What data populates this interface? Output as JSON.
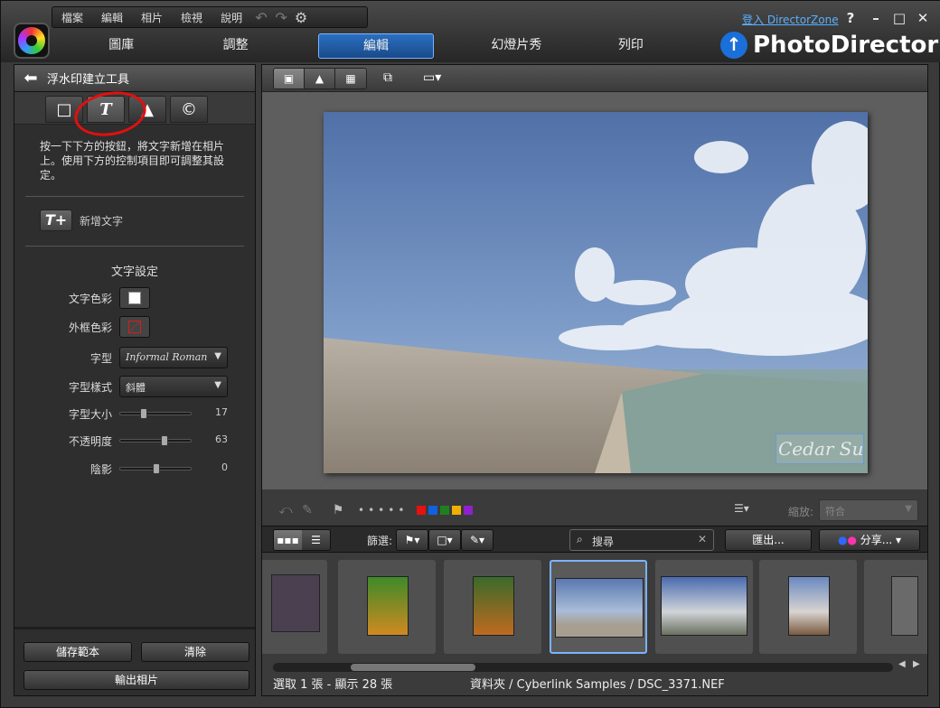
{
  "window": {
    "login_link": "登入 DirectorZone",
    "help": "?",
    "minimize": "–",
    "maximize": "□",
    "close": "✕"
  },
  "menu": [
    "檔案",
    "編輯",
    "相片",
    "檢視",
    "說明"
  ],
  "tabs": [
    "圖庫",
    "調整",
    "編輯",
    "幻燈片秀",
    "列印"
  ],
  "active_tab": "編輯",
  "brand": "PhotoDirector",
  "left_panel": {
    "title": "浮水印建立工具",
    "tool_tabs": [
      "□",
      "T",
      "▲",
      "©"
    ],
    "description": "按一下下方的按鈕，將文字新增在相片上。使用下方的控制項目即可調整其設定。",
    "add_text_icon": "T+",
    "add_text": "新增文字",
    "settings_title": "文字設定",
    "text_color_label": "文字色彩",
    "text_color": "#ffffff",
    "border_color_label": "外框色彩",
    "border_color": "#cc2222",
    "font_label": "字型",
    "font_value": "Informal Roman",
    "style_label": "字型樣式",
    "style_value": "斜體",
    "size_label": "字型大小",
    "size_value": "17",
    "size_level": 0.3,
    "opacity_label": "不透明度",
    "opacity_value": "63",
    "opacity_level": 0.63,
    "shadow_label": "陰影",
    "shadow_value": "0",
    "shadow_level": 0.5,
    "save_template": "儲存範本",
    "clear": "清除",
    "export_photo": "輸出相片"
  },
  "editor": {
    "watermark_text": "Cedar Su",
    "zoom_label": "縮放:",
    "zoom_value": "符合",
    "label_colors": [
      "#e81010",
      "#1060e0",
      "#208020",
      "#f0b000",
      "#9020d0"
    ]
  },
  "filter": {
    "label": "篩選:",
    "search_placeholder": "搜尋",
    "export": "匯出...",
    "share": "分享..."
  },
  "status": {
    "selection": "選取 1 張 - 顯示 28 張",
    "path": "資料夾 / Cyberlink Samples / DSC_3371.NEF"
  }
}
